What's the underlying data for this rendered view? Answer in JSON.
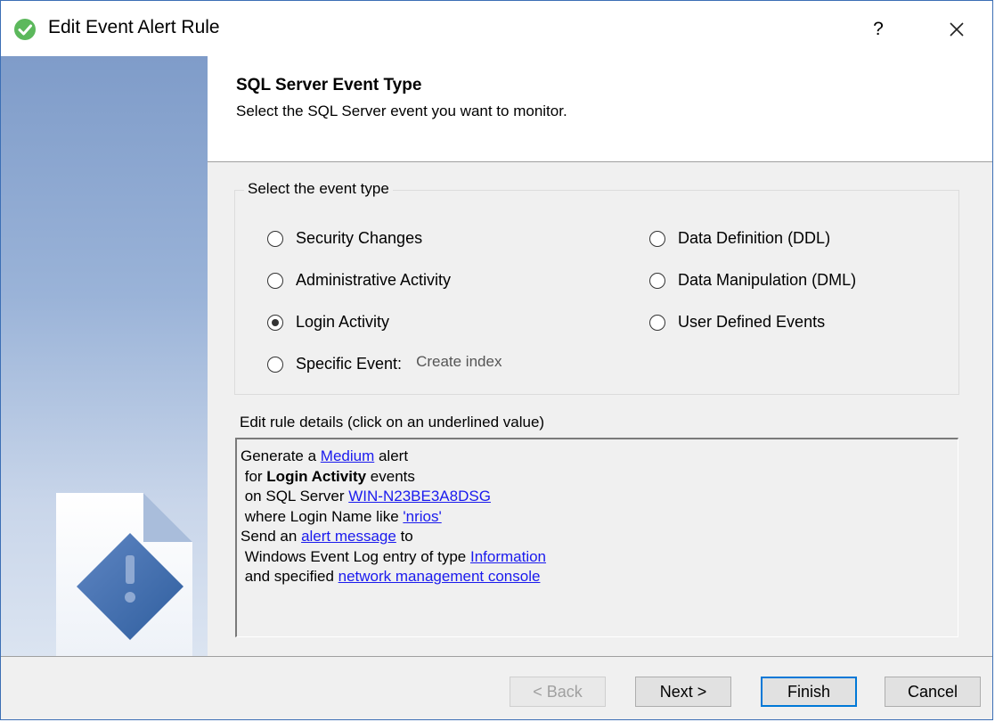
{
  "window": {
    "title": "Edit Event Alert Rule",
    "help_label": "?"
  },
  "header": {
    "title": "SQL Server Event Type",
    "subtitle": "Select the SQL Server event you want to monitor."
  },
  "event_type_group": {
    "legend": "Select the event type",
    "options": [
      {
        "label": "Security Changes",
        "selected": false
      },
      {
        "label": "Administrative Activity",
        "selected": false
      },
      {
        "label": "Login Activity",
        "selected": true
      },
      {
        "label": "Specific Event:",
        "selected": false
      },
      {
        "label": "Data Definition (DDL)",
        "selected": false
      },
      {
        "label": "Data Manipulation (DML)",
        "selected": false
      },
      {
        "label": "User Defined Events",
        "selected": false
      }
    ],
    "specific_event_value": "Create index"
  },
  "rule_details": {
    "label": "Edit rule details (click on an underlined value)",
    "line1_prefix": "Generate a ",
    "line1_link": "Medium",
    "line1_suffix": " alert",
    "line2_prefix": " for ",
    "line2_bold": "Login Activity",
    "line2_suffix": " events",
    "line3_prefix": " on SQL Server ",
    "line3_link": "WIN-N23BE3A8DSG",
    "line4_prefix": " where Login Name like ",
    "line4_link": "'nrios'",
    "line5_prefix": "Send an ",
    "line5_link": "alert message",
    "line5_suffix": " to",
    "line6_prefix": " Windows Event Log entry of type ",
    "line6_link": "Information",
    "line7_prefix": " and specified ",
    "line7_link": "network management console"
  },
  "buttons": {
    "back": "< Back",
    "next": "Next >",
    "finish": "Finish",
    "cancel": "Cancel"
  }
}
